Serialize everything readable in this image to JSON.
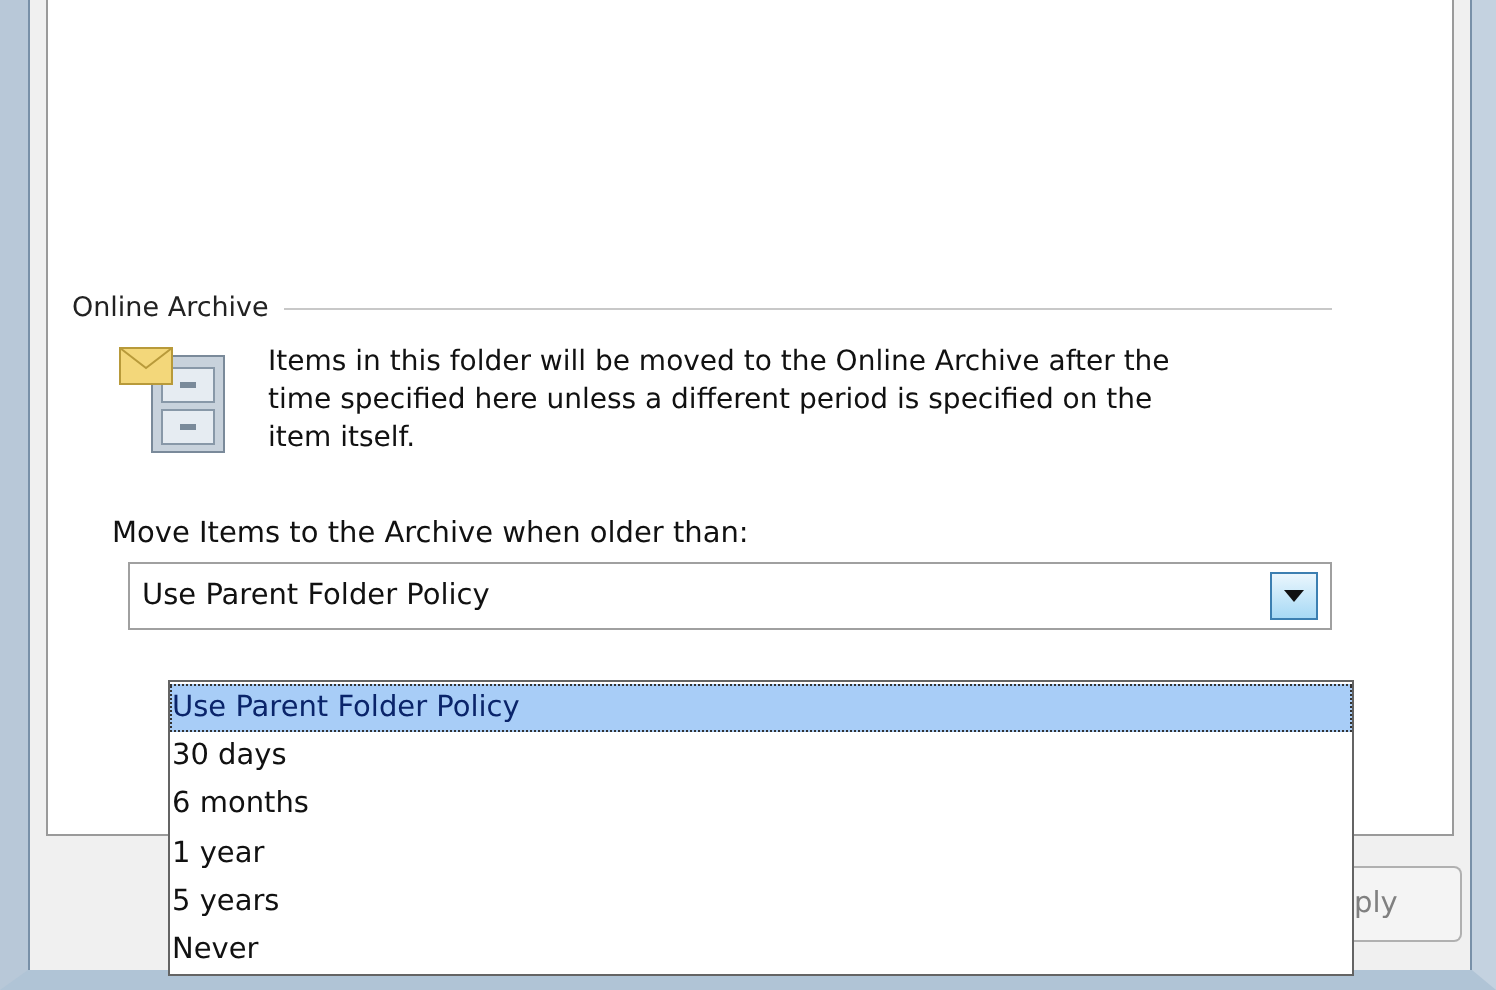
{
  "group": {
    "title": "Online Archive"
  },
  "description": "Items in this folder will be moved to the Online Archive after the time specified here unless a different period is specified on the item itself.",
  "combo_label": "Move Items to the Archive when older than:",
  "combo": {
    "value": "Use Parent Folder Policy",
    "expanded": true
  },
  "options": [
    {
      "label": "Use Parent Folder Policy",
      "selected": true
    },
    {
      "label": "30 days",
      "selected": false
    },
    {
      "label": "6 months",
      "selected": false
    },
    {
      "label": "1 year",
      "selected": false
    },
    {
      "label": "5 years",
      "selected": false
    },
    {
      "label": "Never",
      "selected": false
    }
  ],
  "apply_button": {
    "label": "ply",
    "disabled": true
  }
}
